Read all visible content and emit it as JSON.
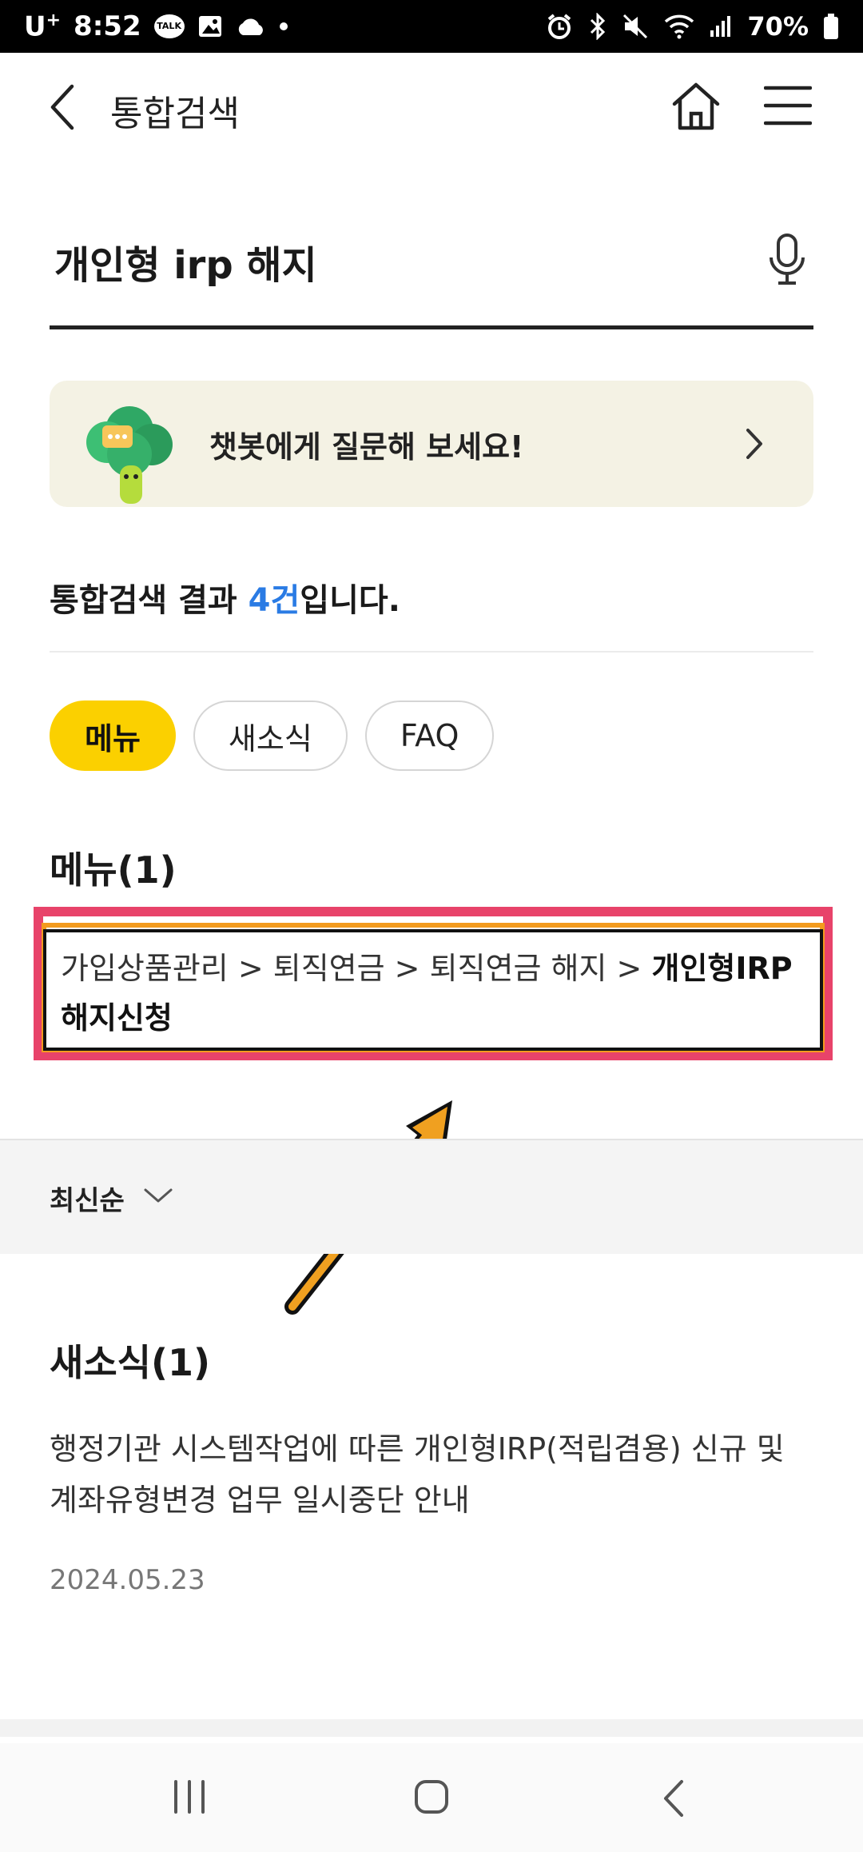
{
  "status_bar": {
    "carrier": "U",
    "carrier_sup": "+",
    "time": "8:52",
    "talk_icon_text": "TALK",
    "battery": "70%"
  },
  "header": {
    "title": "통합검색"
  },
  "search": {
    "query": "개인형 irp 해지"
  },
  "chatbot": {
    "label": "챗봇에게 질문해 보세요!"
  },
  "result": {
    "prefix": "통합검색 결과 ",
    "count": "4건",
    "suffix": "입니다."
  },
  "chips": [
    {
      "label": "메뉴",
      "active": true
    },
    {
      "label": "새소식",
      "active": false
    },
    {
      "label": "FAQ",
      "active": false
    }
  ],
  "menu_section": {
    "title": "메뉴(1)",
    "path_plain": "가입상품관리 > 퇴직연금 > 퇴직연금 해지 > ",
    "path_bold": "개인형IRP 해지신청"
  },
  "sort": {
    "label": "최신순"
  },
  "news_section": {
    "title": "새소식(1)",
    "items": [
      {
        "title": "행정기관 시스템작업에 따른 개인형IRP(적립겸용) 신규 및 계좌유형변경 업무 일시중단 안내",
        "date": "2024.05.23"
      }
    ]
  },
  "colors": {
    "accent_yellow": "#fbd000",
    "link_blue": "#2a7be4",
    "annotation_pink": "#e8436a",
    "annotation_orange": "#f39b1e"
  }
}
